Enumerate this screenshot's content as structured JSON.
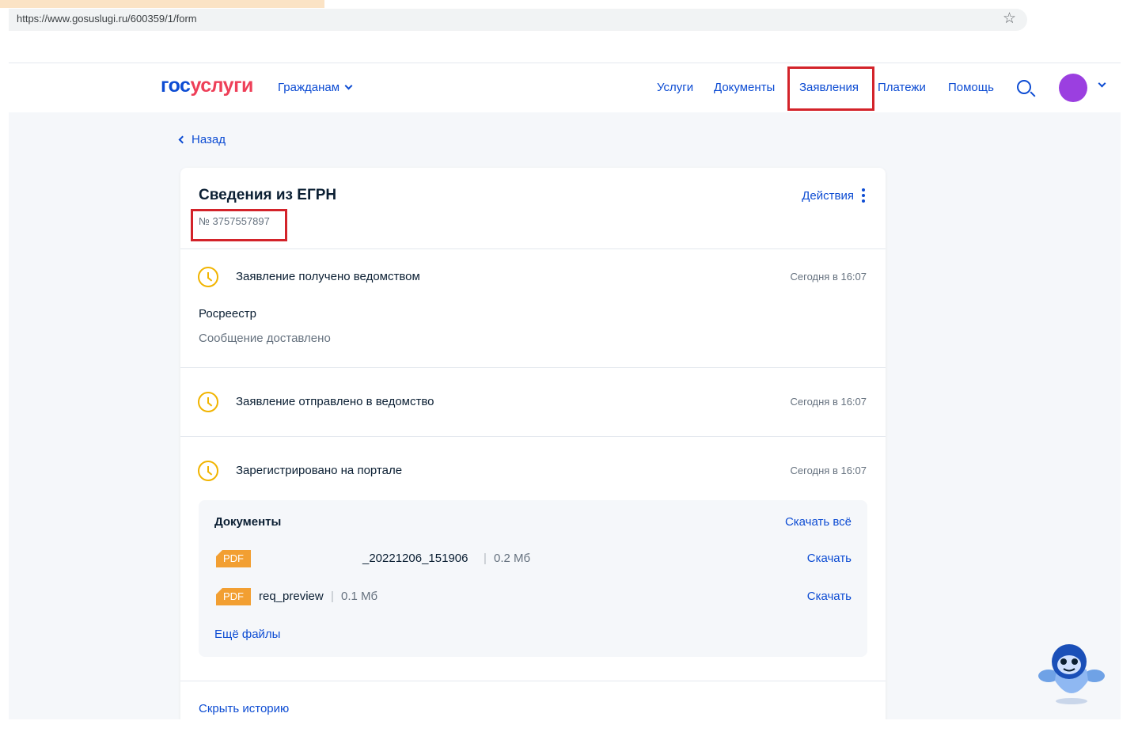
{
  "browser": {
    "url": "https://www.gosuslugi.ru/600359/1/form"
  },
  "header": {
    "logo_gos": "гос",
    "logo_uslugi": "услуги",
    "citizens": "Гражданам",
    "nav": [
      "Услуги",
      "Документы",
      "Заявления",
      "Платежи",
      "Помощь"
    ]
  },
  "back_label": "Назад",
  "card": {
    "title": "Сведения из ЕГРН",
    "number": "№ 3757557897",
    "actions": "Действия",
    "events": [
      {
        "title": "Заявление получено ведомством",
        "time": "Сегодня в 16:07",
        "agency": "Росреестр",
        "status": "Сообщение доставлено"
      },
      {
        "title": "Заявление отправлено в ведомство",
        "time": "Сегодня в 16:07"
      },
      {
        "title": "Зарегистрировано на портале",
        "time": "Сегодня в 16:07"
      }
    ],
    "documents": {
      "title": "Документы",
      "download_all": "Скачать всё",
      "files": [
        {
          "badge": "PDF",
          "name": "_20221206_151906",
          "sep": "|",
          "size": "0.2 Мб",
          "download": "Скачать"
        },
        {
          "badge": "PDF",
          "name": "req_preview",
          "sep": "|",
          "size": "0.1 Мб",
          "download": "Скачать"
        }
      ],
      "more": "Ещё файлы"
    },
    "hide_history": "Скрыть историю"
  },
  "colors": {
    "brand_blue": "#0d4cd3",
    "brand_red": "#ee3f58",
    "highlight_red": "#d3232a",
    "clock_yellow": "#f1b400",
    "pdf_orange": "#f29f32",
    "avatar": "#9b3fe0"
  },
  "icons": [
    "star-icon",
    "chevron-down-icon",
    "search-icon",
    "chevron-left-icon",
    "more-vertical-icon",
    "clock-icon",
    "pdf-icon",
    "assistant-robot-icon"
  ]
}
